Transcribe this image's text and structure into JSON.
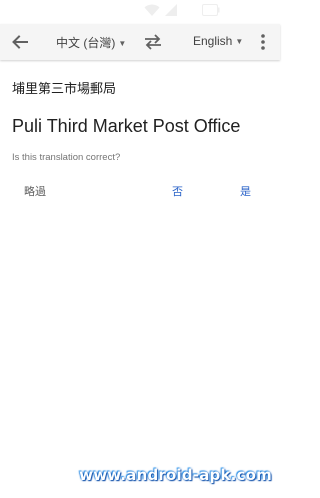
{
  "toolbar": {
    "source_language": "中文 (台灣)",
    "target_language": "English",
    "icons": [
      "arrow-back-icon",
      "chevron-down-icon",
      "swap-icon",
      "more-vert-icon"
    ]
  },
  "translation": {
    "source_text": "埔里第三市場郵局",
    "translated_text": "Puli Third Market Post Office"
  },
  "feedback": {
    "question": "Is this translation correct?",
    "skip_label": "略過",
    "no_label": "否",
    "yes_label": "是"
  },
  "watermark": "www.android-apk.com",
  "colors": {
    "toolbar_bg": "#f5f5f5",
    "accent": "#2962c8",
    "secondary_text": "#757575"
  }
}
